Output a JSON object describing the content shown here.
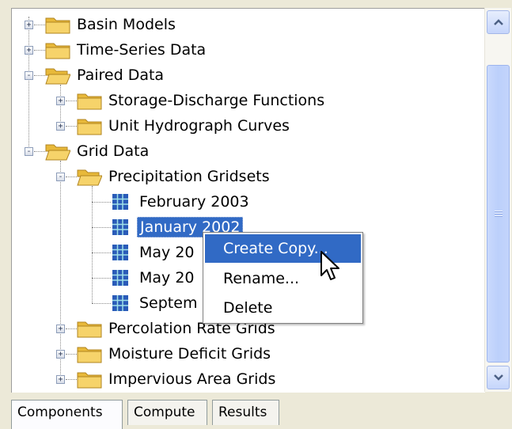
{
  "tree": {
    "nodes": [
      {
        "label": "Basin Models",
        "state": "+"
      },
      {
        "label": "Time-Series Data",
        "state": "+"
      },
      {
        "label": "Paired Data",
        "state": "-"
      },
      {
        "label": "Storage-Discharge Functions",
        "state": "+"
      },
      {
        "label": "Unit Hydrograph Curves",
        "state": "+"
      },
      {
        "label": "Grid Data",
        "state": "-"
      },
      {
        "label": "Precipitation Gridsets",
        "state": "-"
      },
      {
        "label": "February 2003"
      },
      {
        "label": "January 2002"
      },
      {
        "label": "May 20"
      },
      {
        "label": "May 20"
      },
      {
        "label": "Septem"
      },
      {
        "label": "Percolation Rate Grids",
        "state": "+"
      },
      {
        "label": "Moisture Deficit Grids",
        "state": "+"
      },
      {
        "label": "Impervious Area Grids",
        "state": "+"
      }
    ]
  },
  "context_menu": {
    "items": [
      "Create Copy...",
      "Rename...",
      "Delete"
    ]
  },
  "tabs": [
    "Components",
    "Compute",
    "Results"
  ],
  "colors": {
    "selection": "#316ac5",
    "folder": "#f2c447"
  }
}
